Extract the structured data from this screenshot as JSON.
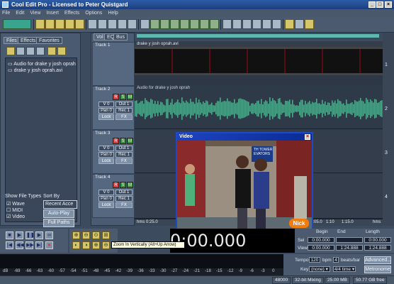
{
  "window": {
    "title": "Cool Edit Pro  -  Licensed to Peter Quistgard"
  },
  "menu": [
    "File",
    "Edit",
    "View",
    "Insert",
    "Effects",
    "Options",
    "Help"
  ],
  "organizer": {
    "tabs": [
      "Files",
      "Effects",
      "Favorites"
    ],
    "files": [
      "Audio for drake y josh oprah",
      "drake y josh oprah.avi"
    ],
    "show_file_types_label": "Show File Types",
    "types": [
      {
        "label": "Wave",
        "checked": true
      },
      {
        "label": "MIDI",
        "checked": false
      },
      {
        "label": "Video",
        "checked": true
      }
    ],
    "sort_by_label": "Sort By",
    "sort_value": "Recent Acce",
    "auto_play": "Auto-Play",
    "full_paths": "Full Paths"
  },
  "view_tabs": [
    "Vol",
    "EQ",
    "Bus"
  ],
  "tracks": [
    {
      "name": "Track 1",
      "caption": "drake y josh oprah.avi"
    },
    {
      "name": "Track 2",
      "caption": "Audio for drake y josh oprah",
      "vol": "V 0",
      "pan": "Pan 0",
      "out": "Out 1",
      "rec": "Rec 1",
      "lock": "Lock",
      "fx": "FX"
    },
    {
      "name": "Track 3",
      "vol": "V 0",
      "pan": "Pan 0",
      "out": "Out 1",
      "rec": "Rec 1",
      "lock": "Lock",
      "fx": "FX"
    },
    {
      "name": "Track 4",
      "vol": "V 0",
      "pan": "Pan 0",
      "out": "Out 1",
      "rec": "Rec 1",
      "lock": "Lock",
      "fx": "FX"
    }
  ],
  "msr": [
    "R",
    "S",
    "M"
  ],
  "lane_numbers": [
    "1",
    "2",
    "3",
    "4"
  ],
  "time_ruler": {
    "left": "hms 0:25.0",
    "right": "hms",
    "ticks": [
      "1:05.0",
      "1:10",
      "1:15.0"
    ]
  },
  "video_window": {
    "title": "Video",
    "sign_text": "TH TOWER\nEVATORS",
    "logo": "Nick"
  },
  "time_display": "0:00.000",
  "tooltip": "Zoom In Vertically    (Alt+Up Arrow)",
  "time_info": {
    "headers": [
      "Begin",
      "End",
      "Length"
    ],
    "sel_label": "Sel",
    "view_label": "View",
    "sel": [
      "0:00.000",
      "",
      "0:00.000"
    ],
    "view": [
      "0:00.000",
      "1:24.888",
      "1:24.888"
    ]
  },
  "tempo_panel": {
    "tempo_label": "Tempo",
    "tempo_value": "120",
    "bpm_label": "bpm",
    "beats_value": "4",
    "beats_label": "beats/bar",
    "key_label": "Key",
    "key_value": "(none)",
    "time_sig": "4/4 time",
    "advanced_btn": "Advanced...",
    "metronome_btn": "Metronome"
  },
  "level_scale": [
    "dB",
    "-69",
    "-66",
    "-63",
    "-60",
    "-57",
    "-54",
    "-51",
    "-48",
    "-45",
    "-42",
    "-39",
    "-36",
    "-33",
    "-30",
    "-27",
    "-24",
    "-21",
    "-18",
    "-15",
    "-12",
    "-9",
    "-6",
    "-3",
    "0"
  ],
  "status": {
    "rate": "48000",
    "depth": "32-bit Mixing",
    "size": "25.00 MB",
    "free": "50.77 GB free"
  },
  "colors": {
    "waveform": "#4fa88c",
    "title_blue": "#1c43c1",
    "record_red": "#d23a3a",
    "solo_green": "#3a8a3a"
  }
}
